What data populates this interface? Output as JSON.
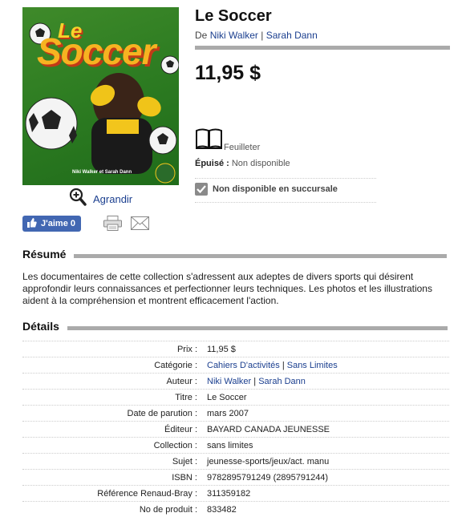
{
  "cover": {
    "title_le": "Le",
    "title_main": "Soccer",
    "authors": "Niki Walker et Sarah Dann"
  },
  "actions": {
    "zoom_label": "Agrandir",
    "like_label": "J'aime 0"
  },
  "product": {
    "title": "Le Soccer",
    "byline_prefix": "De",
    "author1": "Niki Walker",
    "separator": "|",
    "author2": "Sarah Dann",
    "price": "11,95 $",
    "format": "Feuilleter",
    "status_label": "Épuisé :",
    "status_value": "Non disponible",
    "branch_status": "Non disponible en succursale"
  },
  "summary": {
    "heading": "Résumé",
    "text": "Les documentaires de cette collection s'adressent aux adeptes de divers sports qui désirent approfondir leurs connaissances et perfectionner leurs techniques. Les photos et les illustrations aident à la compréhension et montrent efficacement l'action."
  },
  "details": {
    "heading": "Détails",
    "rows": [
      {
        "label": "Prix :",
        "value": "11,95 $"
      },
      {
        "label": "Catégorie :",
        "value": "Cahiers D'activités | Sans Limites"
      },
      {
        "label": "Auteur :",
        "value": "Niki Walker | Sarah Dann"
      },
      {
        "label": "Titre :",
        "value": "Le Soccer"
      },
      {
        "label": "Date de parution :",
        "value": "mars 2007"
      },
      {
        "label": "Éditeur :",
        "value": "BAYARD CANADA JEUNESSE"
      },
      {
        "label": "Collection :",
        "value": "sans limites"
      },
      {
        "label": "Sujet :",
        "value": "jeunesse-sports/jeux/act. manu"
      },
      {
        "label": "ISBN :",
        "value": "9782895791249 (2895791244)"
      },
      {
        "label": "Référence Renaud-Bray :",
        "value": "311359182"
      },
      {
        "label": "No de produit :",
        "value": "833482"
      }
    ],
    "category_link1": "Cahiers D'activités",
    "category_link2": "Sans Limites"
  },
  "colors": {
    "link": "#1b3f8f",
    "rule": "#aaaaaa",
    "like_button": "#4267b2"
  },
  "icons": [
    "zoom-icon",
    "thumbs-up-icon",
    "print-icon",
    "mail-icon",
    "book-icon",
    "check-icon"
  ]
}
